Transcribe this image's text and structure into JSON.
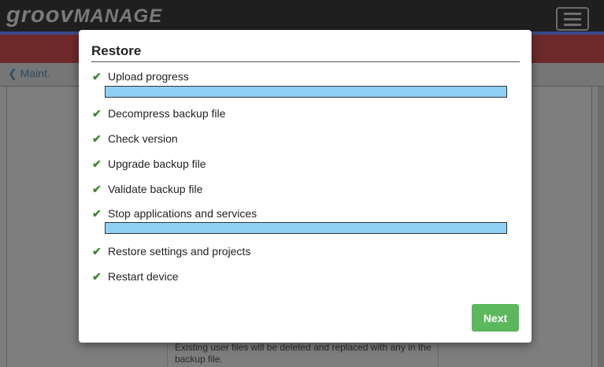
{
  "app": {
    "logo_main": "groov",
    "logo_sub": "MANAGE"
  },
  "nav": {
    "back_label": "Maint."
  },
  "background": {
    "warning_text": "Existing user files will be deleted and replaced with any in the backup file."
  },
  "modal": {
    "title": "Restore",
    "steps": [
      {
        "label": "Upload progress",
        "status": "done",
        "progress": 1.0
      },
      {
        "label": "Decompress backup file",
        "status": "done"
      },
      {
        "label": "Check version",
        "status": "done"
      },
      {
        "label": "Upgrade backup file",
        "status": "done"
      },
      {
        "label": "Validate backup file",
        "status": "done"
      },
      {
        "label": "Stop applications and services",
        "status": "done",
        "progress": 1.0
      },
      {
        "label": "Restore settings and projects",
        "status": "done"
      },
      {
        "label": "Restart device",
        "status": "done"
      }
    ],
    "next_label": "Next"
  },
  "icons": {
    "check": "check-icon",
    "back": "chevron-left-icon",
    "menu": "hamburger-menu-icon"
  },
  "colors": {
    "check": "#3c8a2e",
    "progress_fill": "#8ecff4",
    "next_button": "#5cb85c",
    "header_accent": "#3a4a8c",
    "header_red": "#6e2a2a"
  }
}
